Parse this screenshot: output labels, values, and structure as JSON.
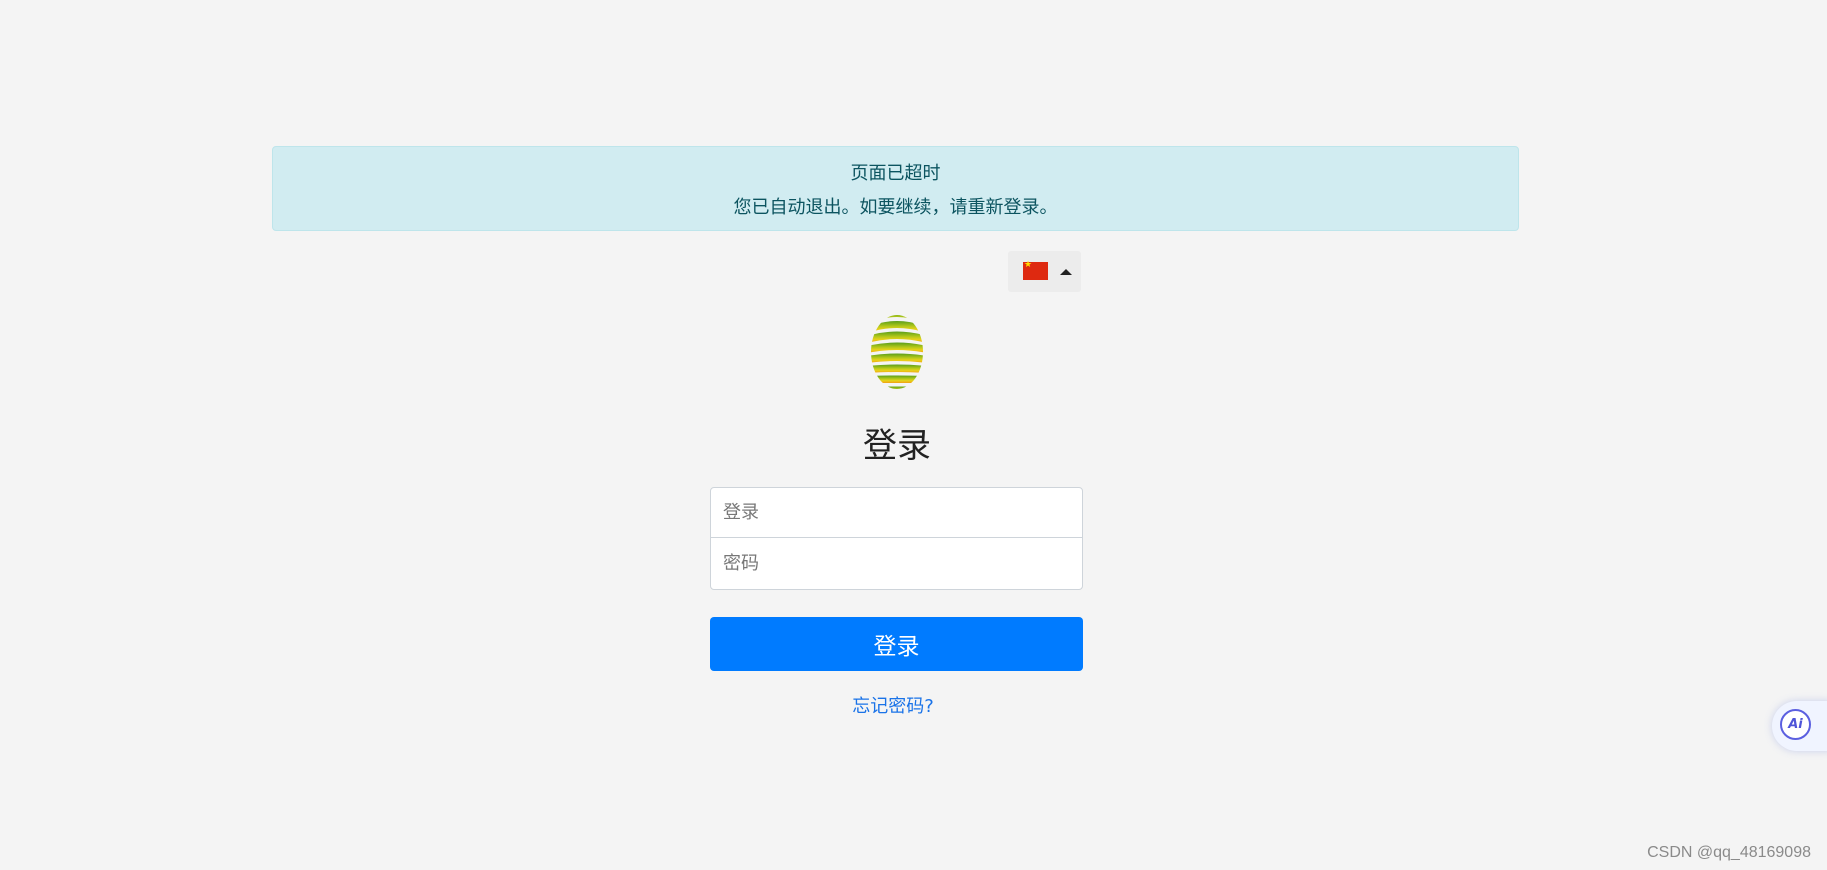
{
  "alert": {
    "title": "页面已超时",
    "message": "您已自动退出。如要继续，请重新登录。"
  },
  "language": {
    "selected": "zh-CN",
    "flag_icon": "china-flag-icon"
  },
  "login": {
    "heading": "登录",
    "login_placeholder": "登录",
    "password_placeholder": "密码",
    "submit_label": "登录",
    "forgot_password": "忘记密码?"
  },
  "ai_widget": {
    "label": "Ai"
  },
  "watermark": "CSDN @qq_48169098",
  "colors": {
    "primary": "#007bff",
    "alert_bg": "#d1ecf1",
    "alert_text": "#0c5460",
    "page_bg": "#f4f4f4"
  }
}
